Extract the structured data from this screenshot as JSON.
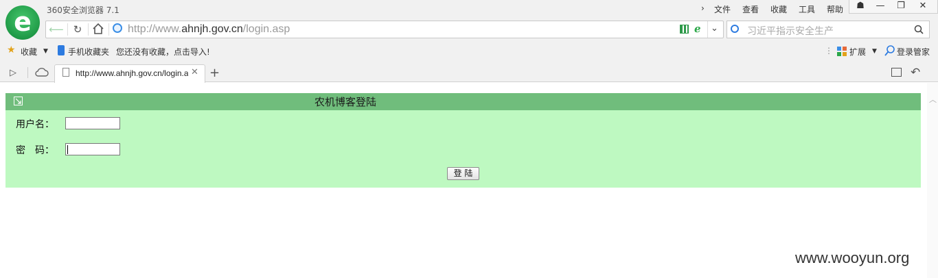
{
  "window": {
    "title": "360安全浏览器 7.1",
    "menu": [
      "文件",
      "查看",
      "收藏",
      "工具",
      "帮助"
    ],
    "menu_arrow": "›",
    "controls": {
      "skin": "☗",
      "minimize": "—",
      "restore": "❐",
      "close": "✕"
    }
  },
  "address_bar": {
    "url_prefix": "http://www.",
    "url_domain": "ahnjh.gov.cn",
    "url_path": "/login.asp",
    "search_placeholder": "习近平指示安全生产"
  },
  "bookmarks_bar": {
    "favorites": "收藏",
    "mobile_favorites": "手机收藏夹",
    "import_hint": "您还没有收藏，点击导入!",
    "extensions": "扩展",
    "login_manager": "登录管家"
  },
  "tabs": [
    {
      "title": "http://www.ahnjh.gov.cn/login.asp",
      "active": true
    }
  ],
  "new_tab": "+",
  "page": {
    "login_title": "农机博客登陆",
    "username_label": "用户名：",
    "password_label": "密　码：",
    "username_value": "",
    "password_value": "",
    "login_button": "登 陆"
  },
  "watermark": "www.wooyun.org",
  "colors": {
    "header_green": "#70bd7c",
    "panel_green": "#bef9c1",
    "logo_green": "#1f9a47"
  }
}
